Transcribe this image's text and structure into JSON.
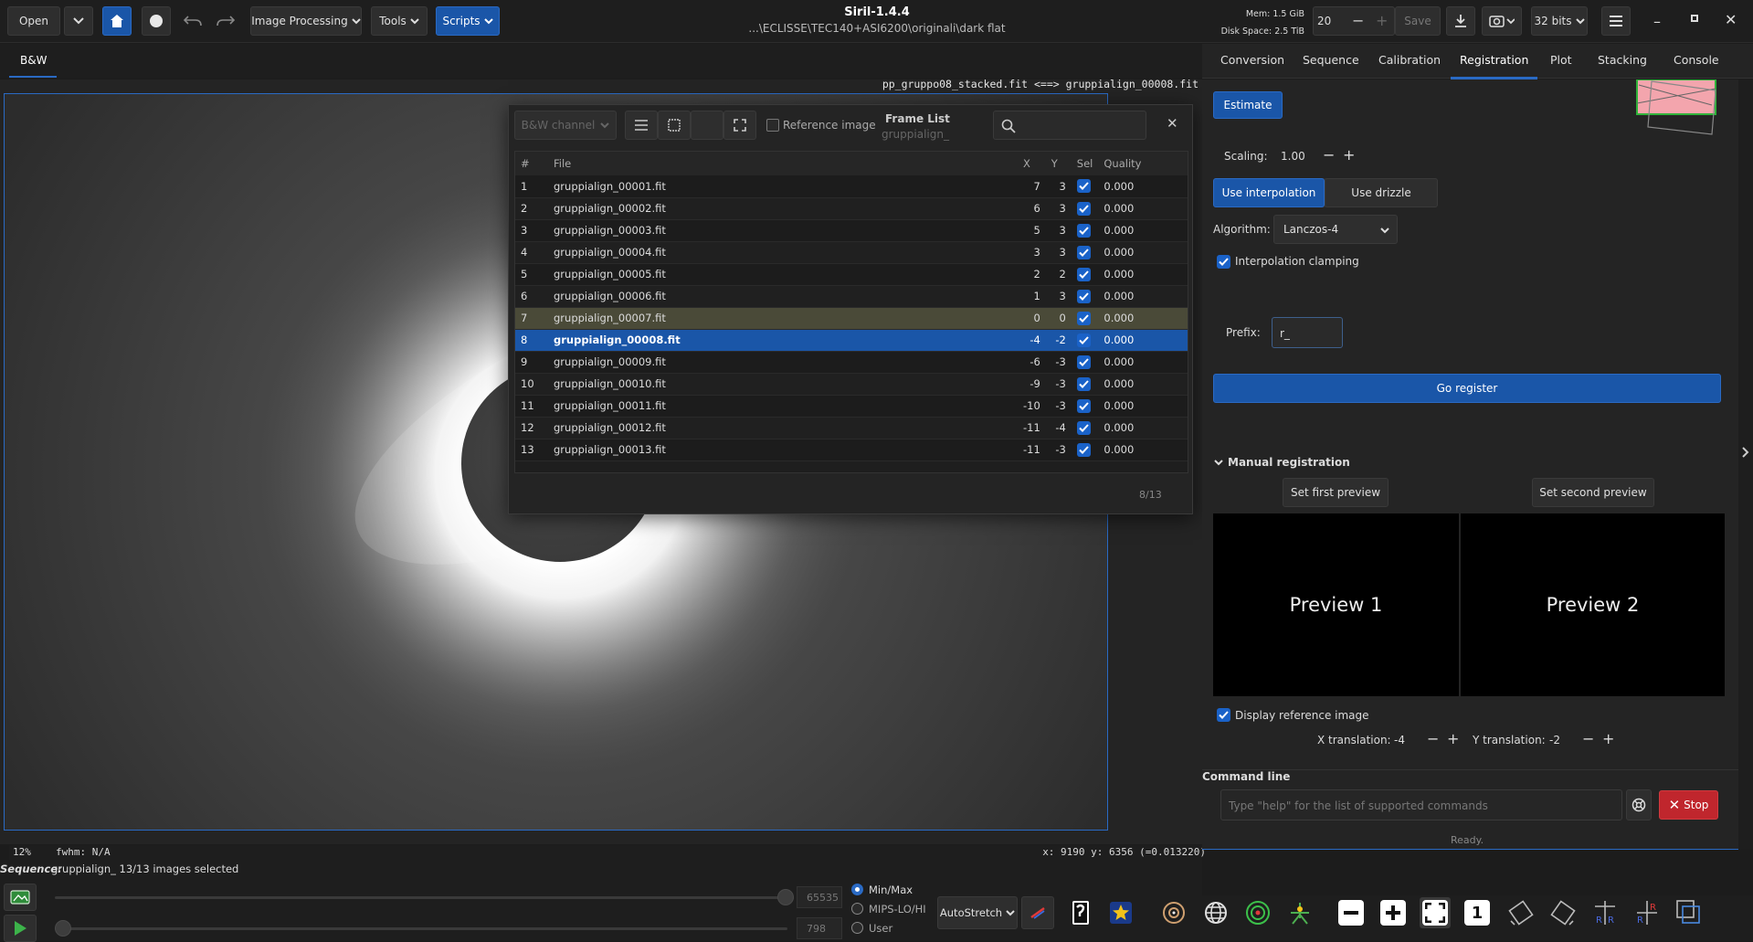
{
  "window": {
    "title": "Siril-1.4.4",
    "path": "...\\ECLISSE\\TEC140+ASI6200\\originali\\dark flat",
    "mem": "Mem: 1.5 GiB",
    "disk": "Disk Space: 2.5 TiB",
    "threads": "20",
    "save": "Save",
    "bits": "32 bits"
  },
  "toolbar": {
    "open": "Open",
    "image_processing": "Image Processing",
    "tools": "Tools",
    "scripts": "Scripts"
  },
  "viewer": {
    "tab": "B&W",
    "compare_label": "pp_gruppo08_stacked.fit <==> gruppialign_00008.fit",
    "zoom": "12%",
    "fwhm": "fwhm: N/A",
    "coords": "x: 9190  y: 6356  (=0.013220)"
  },
  "frame_list": {
    "channel": "B&W channel",
    "reference_image": "Reference image",
    "title": "Frame List",
    "subtitle": "gruppialign_",
    "columns": {
      "num": "#",
      "file": "File",
      "x": "X",
      "y": "Y",
      "sel": "Sel",
      "quality": "Quality"
    },
    "rows": [
      {
        "num": "1",
        "file": "gruppialign_00001.fit",
        "x": "7",
        "y": "3",
        "quality": "0.000"
      },
      {
        "num": "2",
        "file": "gruppialign_00002.fit",
        "x": "6",
        "y": "3",
        "quality": "0.000"
      },
      {
        "num": "3",
        "file": "gruppialign_00003.fit",
        "x": "5",
        "y": "3",
        "quality": "0.000"
      },
      {
        "num": "4",
        "file": "gruppialign_00004.fit",
        "x": "3",
        "y": "3",
        "quality": "0.000"
      },
      {
        "num": "5",
        "file": "gruppialign_00005.fit",
        "x": "2",
        "y": "2",
        "quality": "0.000"
      },
      {
        "num": "6",
        "file": "gruppialign_00006.fit",
        "x": "1",
        "y": "3",
        "quality": "0.000"
      },
      {
        "num": "7",
        "file": "gruppialign_00007.fit",
        "x": "0",
        "y": "0",
        "quality": "0.000"
      },
      {
        "num": "8",
        "file": "gruppialign_00008.fit",
        "x": "-4",
        "y": "-2",
        "quality": "0.000"
      },
      {
        "num": "9",
        "file": "gruppialign_00009.fit",
        "x": "-6",
        "y": "-3",
        "quality": "0.000"
      },
      {
        "num": "10",
        "file": "gruppialign_00010.fit",
        "x": "-9",
        "y": "-3",
        "quality": "0.000"
      },
      {
        "num": "11",
        "file": "gruppialign_00011.fit",
        "x": "-10",
        "y": "-3",
        "quality": "0.000"
      },
      {
        "num": "12",
        "file": "gruppialign_00012.fit",
        "x": "-11",
        "y": "-4",
        "quality": "0.000"
      },
      {
        "num": "13",
        "file": "gruppialign_00013.fit",
        "x": "-11",
        "y": "-3",
        "quality": "0.000"
      }
    ],
    "counter": "8/13"
  },
  "right_tabs": [
    "Conversion",
    "Sequence",
    "Calibration",
    "Registration",
    "Plot",
    "Stacking",
    "Console"
  ],
  "registration": {
    "estimate": "Estimate",
    "scaling_label": "Scaling:",
    "scaling_value": "1.00",
    "use_interpolation": "Use interpolation",
    "use_drizzle": "Use drizzle",
    "algorithm_label": "Algorithm:",
    "algorithm_value": "Lanczos-4",
    "interp_clamping": "Interpolation clamping",
    "prefix_label": "Prefix:",
    "prefix_value": "r_",
    "go_register": "Go register",
    "manual_registration": "Manual registration",
    "set_first_preview": "Set first preview",
    "set_second_preview": "Set second preview",
    "preview1": "Preview 1",
    "preview2": "Preview 2",
    "display_reference": "Display reference image",
    "x_translation_label": "X translation:",
    "x_translation_value": "-4",
    "y_translation_label": "Y translation:",
    "y_translation_value": "-2"
  },
  "command_line": {
    "label": "Command line",
    "placeholder": "Type \"help\" for the list of supported commands",
    "stop": "Stop",
    "status": "Ready."
  },
  "bottom": {
    "sequence_label": "Sequence:",
    "sequence_text": "gruppialign_  13/13 images selected",
    "high_value": "65535",
    "low_value": "798",
    "radio_minmax": "Min/Max",
    "radio_mips": "MIPS-LO/HI",
    "radio_user": "User",
    "autostretch": "AutoStretch"
  },
  "colors": {
    "accent": "#1a56a8",
    "selected_row": "#1a56a8",
    "reference_row": "#4a4a38",
    "stop": "#c0262d"
  }
}
